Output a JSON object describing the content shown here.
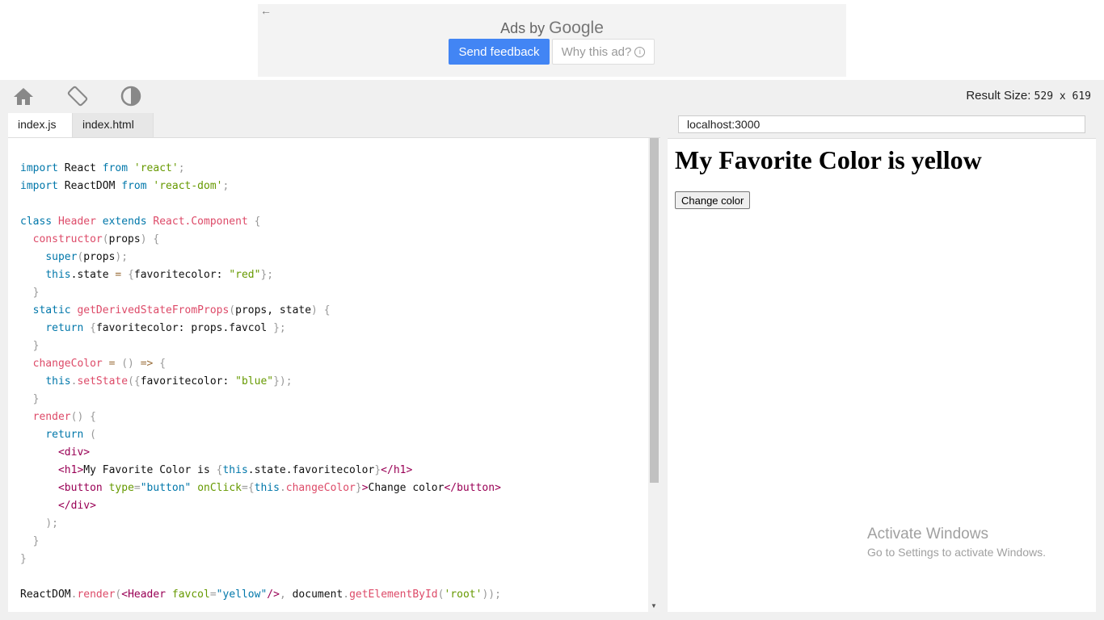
{
  "ad": {
    "back": "←",
    "ads_by": "Ads by",
    "google": "Google",
    "send_feedback": "Send feedback",
    "why_this_ad": "Why this ad?",
    "info_glyph": "i"
  },
  "toolbar": {
    "icons": [
      "home-icon",
      "rotate-icon",
      "contrast-icon"
    ],
    "result_size_label": "Result Size:",
    "result_size_value": "529 x 619"
  },
  "editor": {
    "tabs": [
      {
        "label": "index.js",
        "active": true
      },
      {
        "label": "index.html",
        "active": false
      }
    ],
    "code": {
      "l1": [
        "import",
        " React ",
        "from",
        " ",
        "'react'",
        ";"
      ],
      "l2": [
        "import",
        " ReactDOM ",
        "from",
        " ",
        "'react-dom'",
        ";"
      ],
      "l4": [
        "class",
        " ",
        "Header",
        " ",
        "extends",
        " ",
        "React.Component",
        " ",
        "{"
      ],
      "l5": [
        "  ",
        "constructor",
        "(",
        "props",
        ")",
        " ",
        "{"
      ],
      "l6": [
        "    ",
        "super",
        "(",
        "props",
        ");"
      ],
      "l7": [
        "    ",
        "this",
        ".state ",
        "=",
        " ",
        "{",
        "favoritecolor: ",
        "\"red\"",
        "};"
      ],
      "l8": [
        "  ",
        "}"
      ],
      "l9": [
        "  ",
        "static",
        " ",
        "getDerivedStateFromProps",
        "(",
        "props, state",
        ")",
        " ",
        "{"
      ],
      "l10": [
        "    ",
        "return",
        " ",
        "{",
        "favoritecolor: props.favcol ",
        "};"
      ],
      "l11": [
        "  ",
        "}"
      ],
      "l12": [
        "  ",
        "changeColor",
        " ",
        "=",
        " ",
        "()",
        " ",
        "=>",
        " ",
        "{"
      ],
      "l13": [
        "    ",
        "this",
        ".",
        "setState",
        "({",
        "favoritecolor: ",
        "\"blue\"",
        "});"
      ],
      "l14": [
        "  ",
        "}"
      ],
      "l15": [
        "  ",
        "render",
        "()",
        " ",
        "{"
      ],
      "l16": [
        "    ",
        "return",
        " ",
        "("
      ],
      "l17": [
        "      ",
        "<div",
        ">"
      ],
      "l18": [
        "      ",
        "<h1",
        ">",
        "My Favorite Color is ",
        "{",
        "this",
        ".state.favoritecolor",
        "}",
        "</h1",
        ">"
      ],
      "l19": [
        "      ",
        "<button",
        " ",
        "type",
        "=",
        "\"button\"",
        " ",
        "onClick",
        "=",
        "{",
        "this",
        ".",
        "changeColor",
        "}",
        ">",
        "Change color",
        "</button",
        ">"
      ],
      "l20": [
        "      ",
        "</div",
        ">"
      ],
      "l21": [
        "    ",
        ");"
      ],
      "l22": [
        "  ",
        "}"
      ],
      "l23": [
        "}"
      ],
      "l25": [
        "ReactDOM",
        ".",
        "render",
        "(",
        "<Header",
        " ",
        "favcol",
        "=",
        "\"yellow\"",
        "/>",
        ",",
        " document",
        ".",
        "getElementById",
        "(",
        "'root'",
        "));"
      ]
    }
  },
  "result": {
    "url": "localhost:3000",
    "heading": "My Favorite Color is yellow",
    "button_label": "Change color"
  },
  "watermark": {
    "line1": "Activate Windows",
    "line2": "Go to Settings to activate Windows."
  },
  "colors": {
    "keyword": "#0077aa",
    "function": "#dd4a68",
    "string": "#669900",
    "tag": "#990055",
    "punctuation": "#999999",
    "ad_button": "#4285f4"
  }
}
